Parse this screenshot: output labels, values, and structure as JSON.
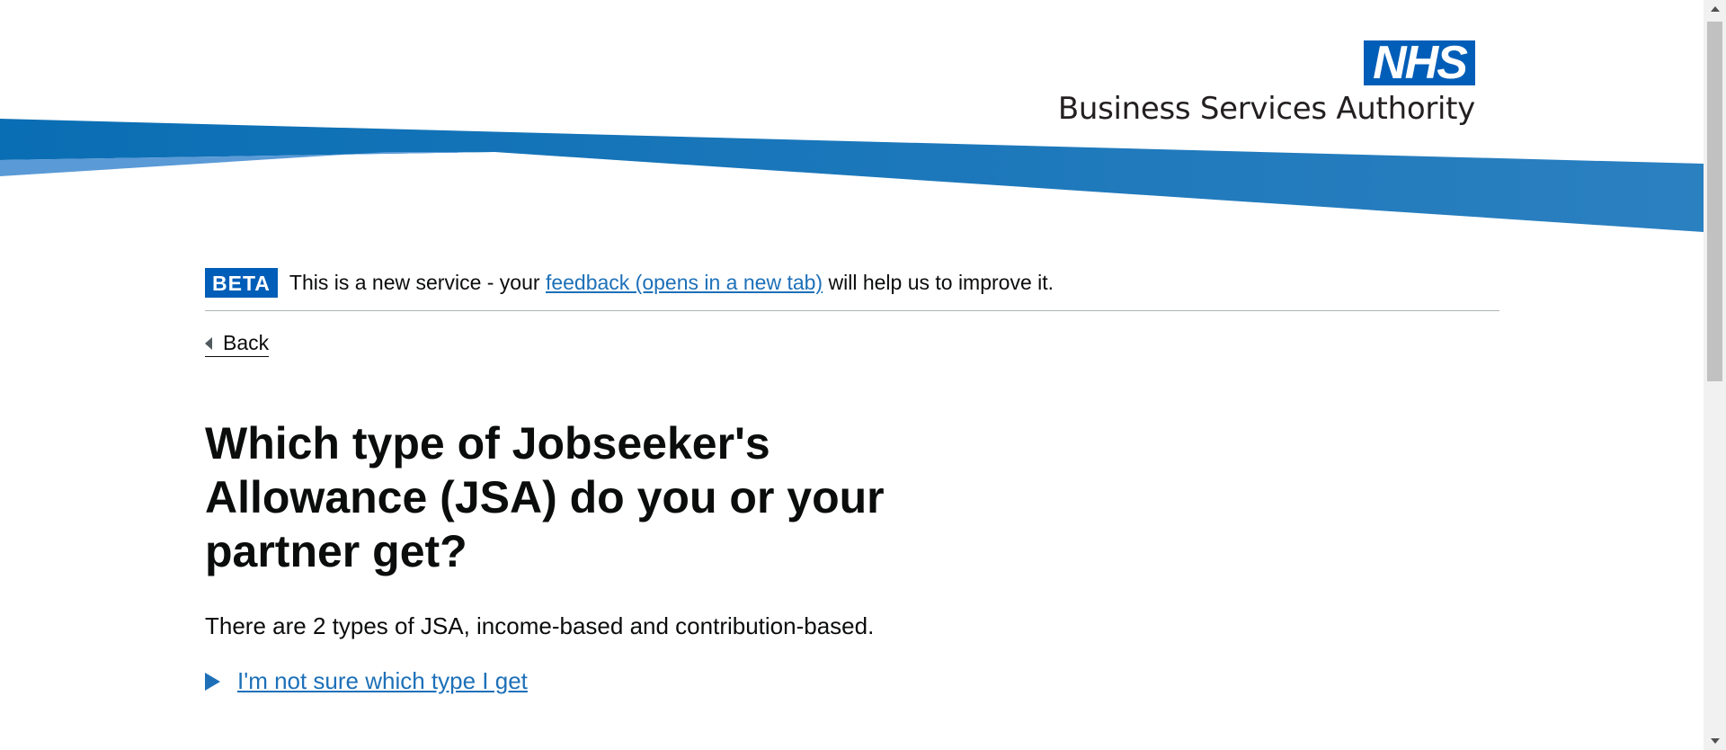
{
  "header": {
    "logo_mark": "NHS",
    "org_name": "Business Services Authority",
    "brand_color": "#005eb8",
    "band_color": "#1d70b8"
  },
  "phase_banner": {
    "tag": "BETA",
    "text_before": "This is a new service - your ",
    "link_text": "feedback (opens in a new tab)",
    "text_after": " will help us to improve it."
  },
  "back_link": {
    "label": "Back",
    "icon": "chevron-left-icon"
  },
  "question": {
    "title": "Which type of Jobseeker's Allowance (JSA) do you or your partner get?",
    "hint": "There are 2 types of JSA, income-based and contribution-based.",
    "details_summary": "I'm not sure which type I get",
    "details_icon": "triangle-right-icon"
  },
  "colors": {
    "link": "#1d70b8",
    "text": "#0b0c0c"
  }
}
